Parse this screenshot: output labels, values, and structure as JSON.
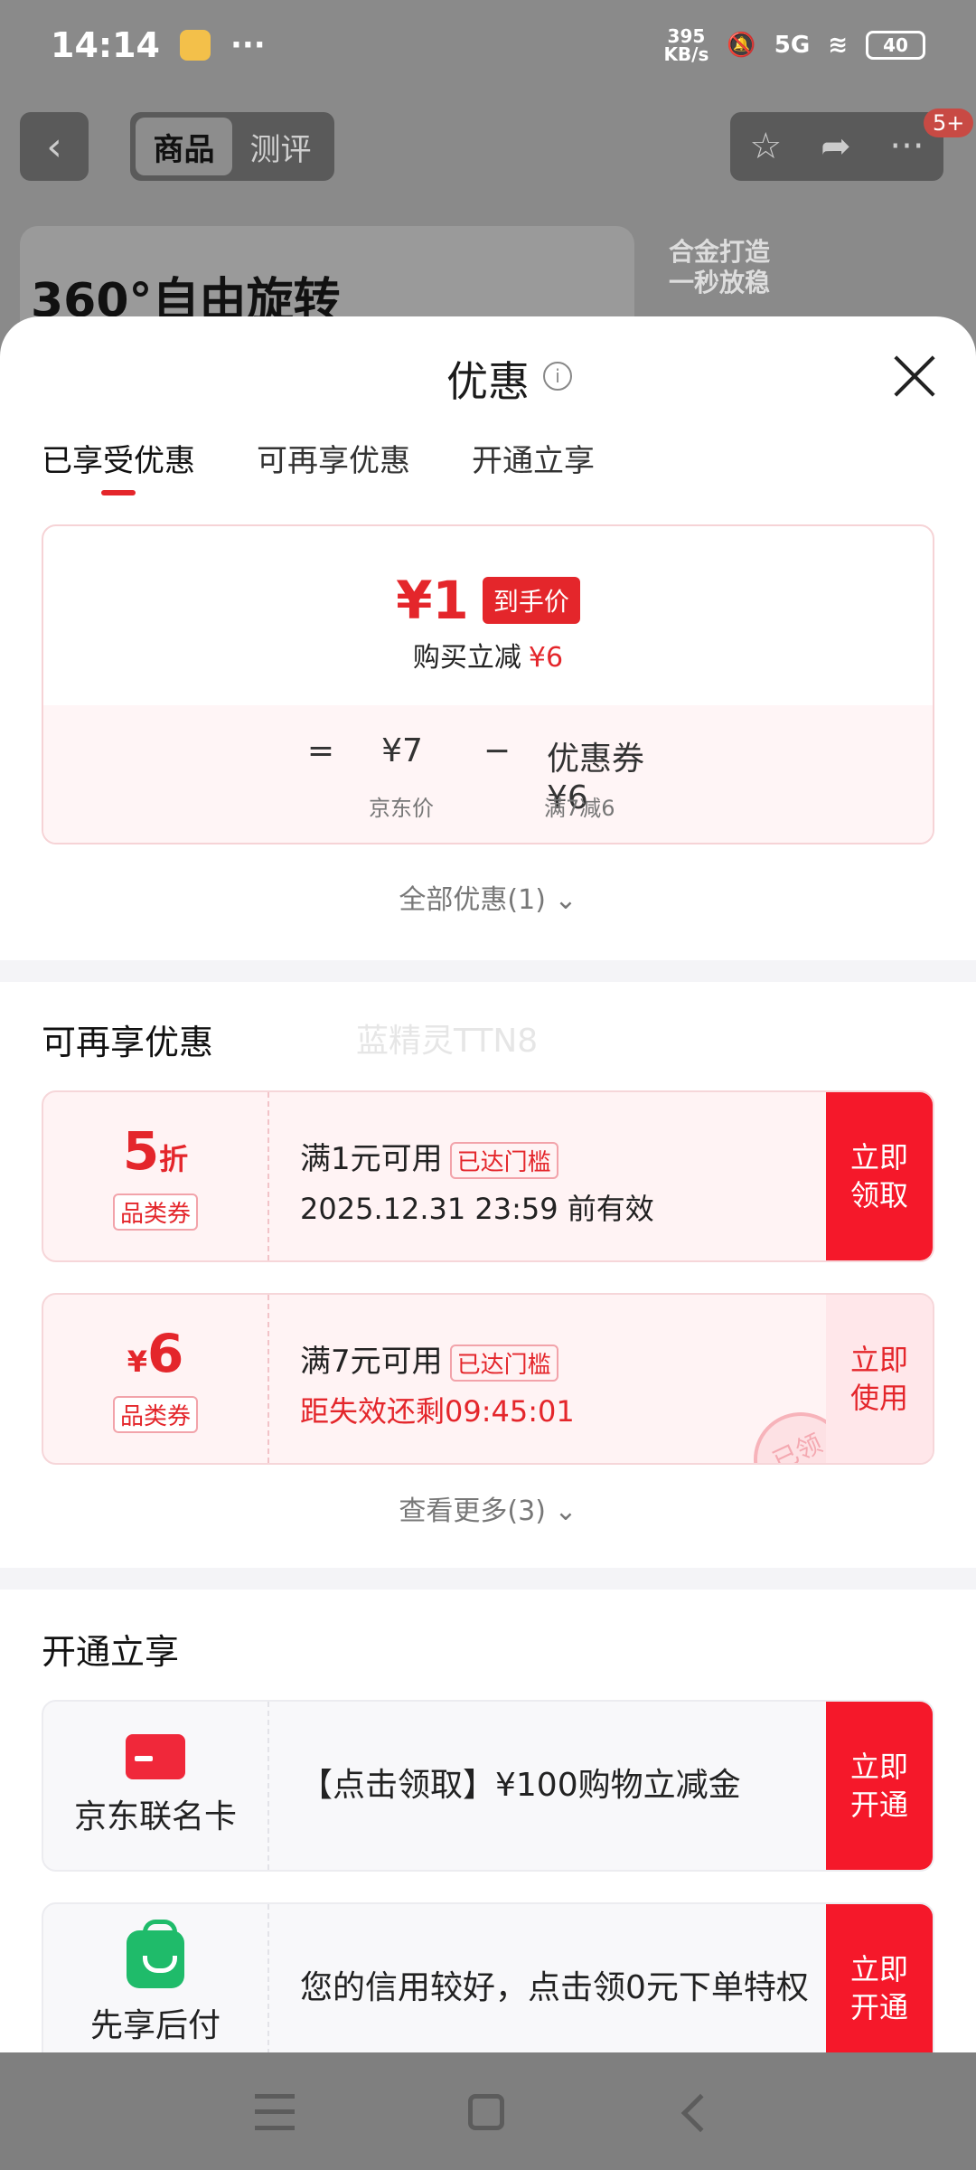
{
  "status_bar": {
    "time": "14:14",
    "more": "···",
    "net_speed_top": "395",
    "net_speed_bottom": "KB/s",
    "signal": "5G",
    "battery": "40"
  },
  "top_nav": {
    "back": "‹",
    "tabs": [
      "商品",
      "测评"
    ],
    "badge": "5+"
  },
  "banner": {
    "left_title": "360°自由旋转",
    "right_text_1": "合金打造",
    "right_text_2": "一秒放稳"
  },
  "sheet": {
    "title": "优惠",
    "info_icon": "i",
    "tabs": [
      "已享受优惠",
      "可再享优惠",
      "开通立享"
    ],
    "price": {
      "final": "¥1",
      "tag": "到手价",
      "sub_label": "购买立减",
      "sub_value": "¥6",
      "eq": "=",
      "jd_price": "¥7",
      "minus": "−",
      "coupon_text": "优惠券 ¥6",
      "jd_label": "京东价",
      "coupon_label": "满7减6"
    },
    "all_deals": "全部优惠(1) ⌄",
    "more_section": {
      "title": "可再享优惠",
      "watermark": "蓝精灵TTN8",
      "coupons": [
        {
          "value": "5",
          "unit": "折",
          "type": "品类券",
          "condition": "满1元可用",
          "chip": "已达门槛",
          "validity": "2025.12.31 23:59 前有效",
          "button": "立即\n领取"
        },
        {
          "value": "6",
          "unit": "¥",
          "type": "品类券",
          "condition": "满7元可用",
          "chip": "已达门槛",
          "validity": "距失效还剩09:45:01",
          "button": "立即\n使用",
          "stamp": "已领"
        }
      ],
      "see_more": "查看更多(3) ⌄"
    },
    "open_section": {
      "title": "开通立享",
      "services": [
        {
          "name": "京东联名卡",
          "icon": "card-icon",
          "text": "【点击领取】¥100购物立减金",
          "button": "立即\n开通"
        },
        {
          "name": "先享后付",
          "icon": "bag-icon",
          "text": "您的信用较好，点击领0元下单特权",
          "button": "立即\n开通"
        }
      ]
    }
  },
  "colors": {
    "accent": "#e4262b",
    "button_red": "#f5182a",
    "green": "#1fbb6a"
  }
}
